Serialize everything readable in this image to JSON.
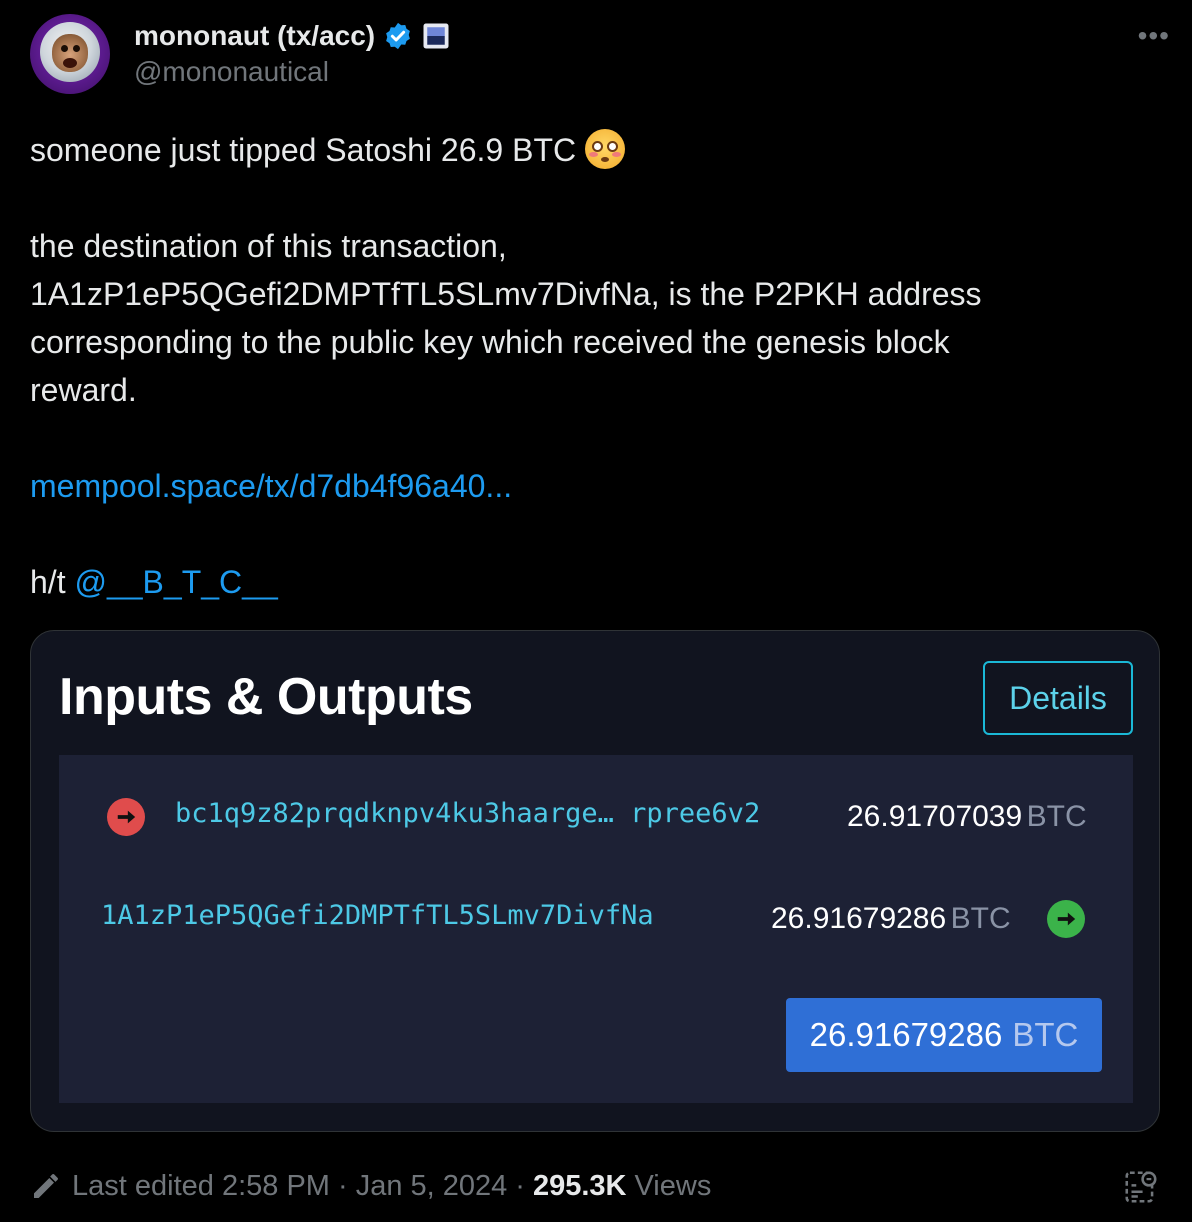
{
  "author": {
    "display_name": "mononaut (tx/acc)",
    "handle": "@mononautical"
  },
  "tweet": {
    "line1": "someone just tipped Satoshi 26.9 BTC",
    "line2": "the destination of this transaction,",
    "line3": "1A1zP1eP5QGefi2DMPTfTL5SLmv7DivfNa, is the P2PKH address",
    "line4": "corresponding to the public key which received the genesis block",
    "line5": "reward.",
    "link": "mempool.space/tx/d7db4f96a40...",
    "ht_prefix": "h/t",
    "mention": "@__B_T_C__"
  },
  "card": {
    "title": "Inputs & Outputs",
    "details_label": "Details",
    "input": {
      "address": "bc1q9z82prqdknpv4ku3haarge… rpree6v2",
      "amount": "26.91707039",
      "unit": "BTC"
    },
    "output": {
      "address": "1A1zP1eP5QGefi2DMPTfTL5SLmv7DivfNa",
      "amount": "26.91679286",
      "unit": "BTC"
    },
    "total": {
      "amount": "26.91679286",
      "unit": "BTC"
    }
  },
  "footer": {
    "edited": "Last edited 2:58 PM · Jan 5, 2024",
    "sep": "·",
    "views_count": "295.3K",
    "views_label": "Views"
  },
  "colors": {
    "link": "#1d9bf0",
    "card_bg": "#11141f",
    "panel_bg": "#1d2135",
    "address": "#4dc9e6",
    "total_bg": "#2f6fd6"
  },
  "icons": [
    "verified-badge-icon",
    "affiliate-badge-icon",
    "more-icon",
    "flushed-face-emoji",
    "input-arrow-icon",
    "output-arrow-icon",
    "pencil-icon",
    "analytics-icon"
  ]
}
